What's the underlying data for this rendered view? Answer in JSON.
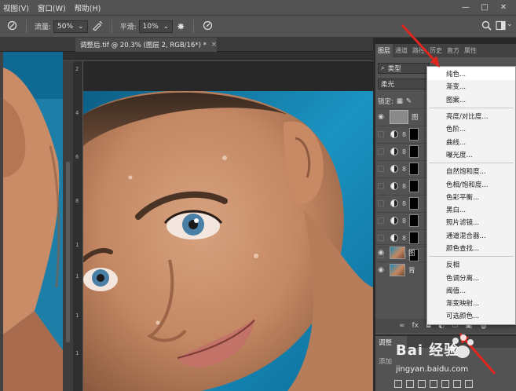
{
  "menubar": {
    "items": [
      "视图(V)",
      "窗口(W)",
      "帮助(H)"
    ],
    "window_controls": [
      "—",
      "□",
      "✕"
    ]
  },
  "options_bar": {
    "flow_label": "流量:",
    "flow_value": "50%",
    "smooth_label": "平滑:",
    "smooth_value": "10%"
  },
  "document": {
    "tab_title": "调整后.tif @ 20.3% (图层 2, RGB/16*) *",
    "close": "×"
  },
  "ruler": {
    "left_numbers": [
      "2",
      "4",
      "6",
      "8",
      "1",
      "1",
      "1",
      "1"
    ]
  },
  "layers_panel": {
    "tabs": [
      "图层",
      "通道",
      "路径",
      "历史",
      "直方",
      "属性"
    ],
    "filter_kind": "类型",
    "blend_mode": "柔光",
    "lock_label": "锁定:",
    "layers": [
      {
        "name": "图",
        "type": "fill"
      },
      {
        "name": "",
        "type": "adjustment"
      },
      {
        "name": "",
        "type": "adjustment"
      },
      {
        "name": "",
        "type": "adjustment"
      },
      {
        "name": "",
        "type": "adjustment"
      },
      {
        "name": "",
        "type": "adjustment"
      },
      {
        "name": "",
        "type": "adjustment"
      },
      {
        "name": "",
        "type": "adjustment"
      },
      {
        "name": "图",
        "type": "photo"
      },
      {
        "name": "背",
        "type": "photo"
      }
    ],
    "footer_fx": "fx"
  },
  "adjust_panel": {
    "tab": "调整",
    "hint": "添加"
  },
  "context_menu": {
    "groups": [
      [
        "纯色...",
        "渐变...",
        "图案..."
      ],
      [
        "亮度/对比度...",
        "色阶...",
        "曲线...",
        "曝光度..."
      ],
      [
        "自然饱和度...",
        "色相/饱和度...",
        "色彩平衡...",
        "黑白...",
        "照片滤镜...",
        "通道混合器...",
        "颜色查找..."
      ],
      [
        "反相",
        "色调分离...",
        "阈值...",
        "渐变映射...",
        "可选颜色..."
      ]
    ]
  },
  "watermark": {
    "text": "Bai 经验",
    "url": "jingyan.baidu.com"
  },
  "colors": {
    "arrow": "#e0261f",
    "panel": "#535353",
    "menu_bg": "#f3f3f3"
  }
}
